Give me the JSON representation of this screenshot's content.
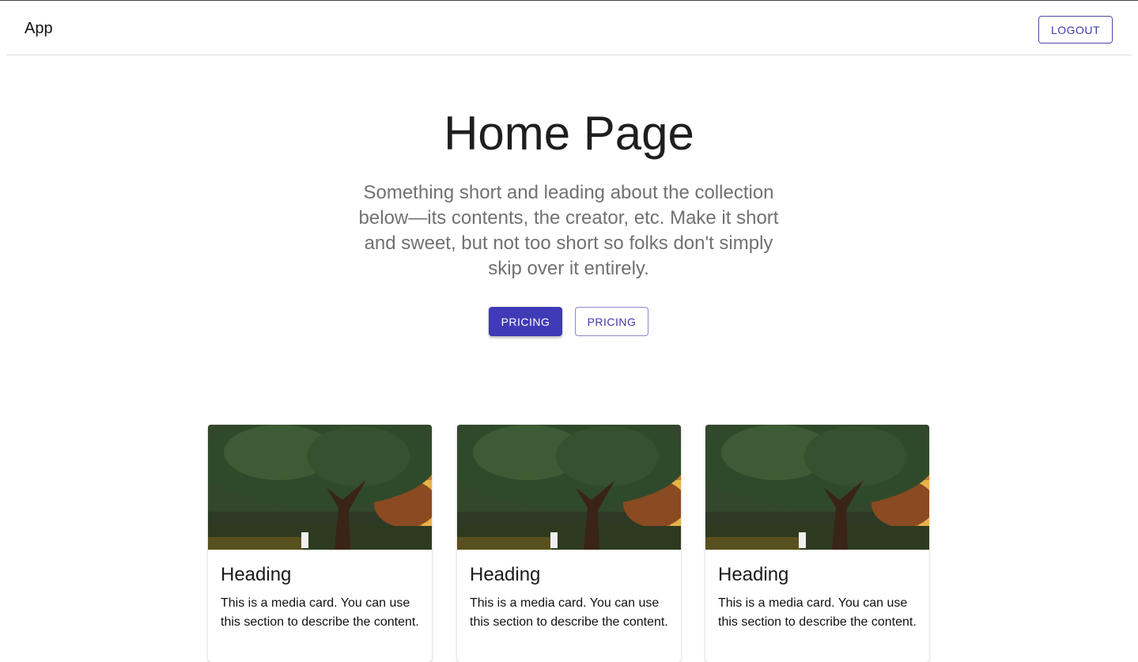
{
  "header": {
    "app_title": "App",
    "logout_label": "LOGOUT"
  },
  "hero": {
    "title": "Home Page",
    "subtitle": "Something short and leading about the collection below—its contents, the creator, etc. Make it short and sweet, but not too short so folks don't simply skip over it entirely.",
    "primary_button_label": "PRICING",
    "secondary_button_label": "PRICING"
  },
  "cards": [
    {
      "heading": "Heading",
      "text": "This is a media card. You can use this section to describe the content."
    },
    {
      "heading": "Heading",
      "text": "This is a media card. You can use this section to describe the content."
    },
    {
      "heading": "Heading",
      "text": "This is a media card. You can use this section to describe the content."
    }
  ],
  "colors": {
    "primary": "#3f3ab6",
    "text_muted": "#717171"
  }
}
